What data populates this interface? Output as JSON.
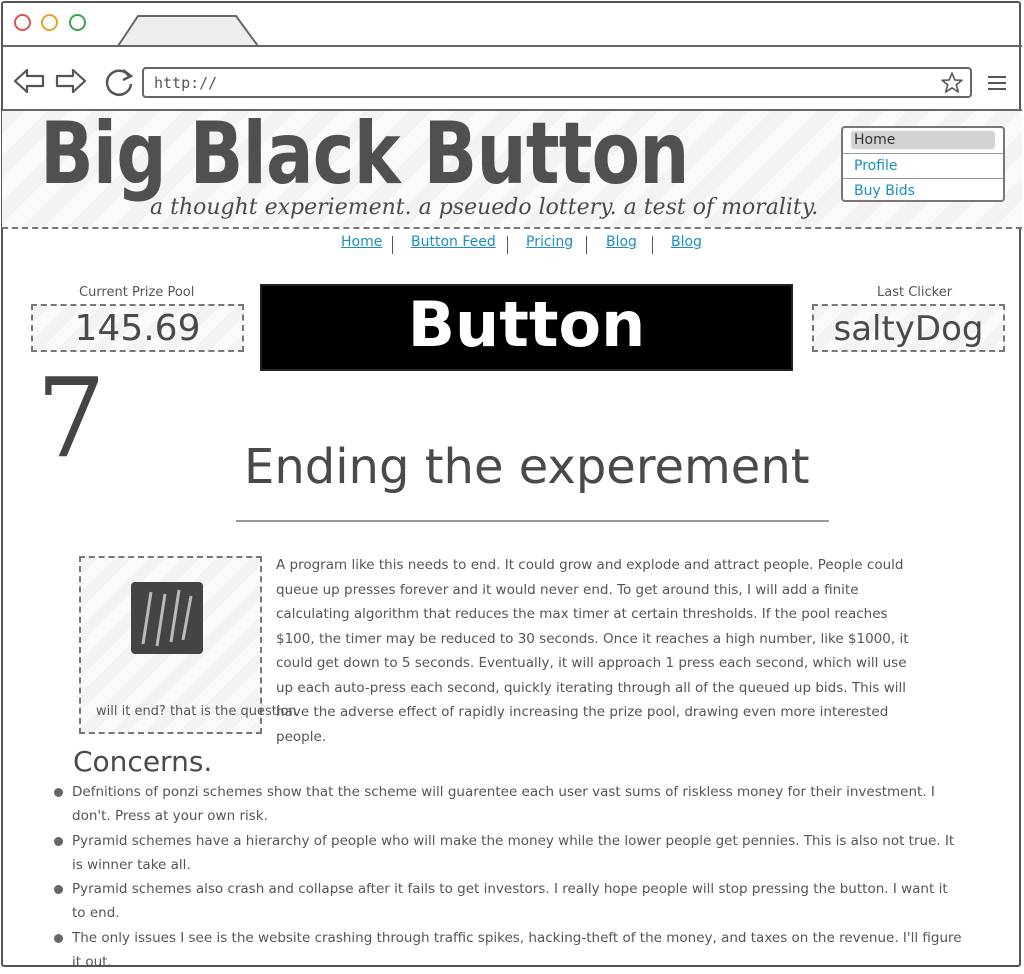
{
  "browser": {
    "url": "http://"
  },
  "header": {
    "title": "Big Black Button",
    "tagline": "a thought experiement. a pseuedo lottery. a test of morality."
  },
  "side_menu": {
    "items": [
      "Home",
      "Profile",
      "Buy Bids"
    ]
  },
  "top_nav": {
    "links": [
      "Home",
      "Button Feed",
      "Pricing",
      "Blog",
      "Blog"
    ]
  },
  "prize": {
    "label": "Current Prize Pool",
    "value": "145.69"
  },
  "button": {
    "label": "Button"
  },
  "clicker": {
    "label": "Last Clicker",
    "value": "saltyDog"
  },
  "countdown": "7",
  "article": {
    "heading": "Ending the experement",
    "image_caption": "will it end? that is the question",
    "body": "A program like this needs to end. It could grow and explode and attract people. People could queue up presses forever and it would never end. To get around this, I will add a finite calculating algorithm that reduces the max timer at certain thresholds. If the pool reaches $100, the timer may be reduced to 30 seconds. Once it reaches a high number, like $1000, it could get down to 5 seconds. Eventually, it will approach 1 press each second, which will use up each auto-press each second, quickly iterating through all of the queued up bids. This will have the adverse effect of rapidly increasing the prize pool, drawing even more interested people."
  },
  "concerns": {
    "heading": "Concerns.",
    "items": [
      "Defnitions of ponzi schemes show that the scheme will guarentee each user vast sums of riskless money for their investment. I don't. Press at your own risk.",
      "Pyramid schemes have a hierarchy of people who will make the money while the lower people get pennies. This is also not true. It is winner take all.",
      "Pyramid  schemes also crash and collapse after it fails to get investors. I really hope people will stop pressing the button. I want it to end.",
      "The only issues I see is the website crashing through traffic spikes, hacking-theft of the money, and taxes on the revenue. I'll figure it out."
    ]
  }
}
